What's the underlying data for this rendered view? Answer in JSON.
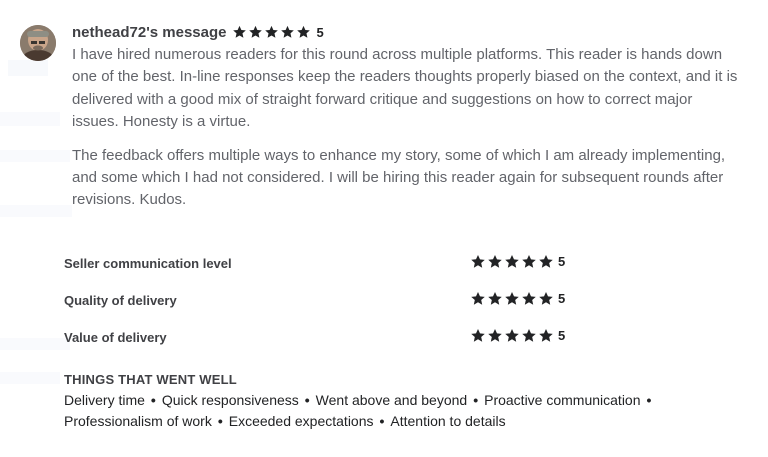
{
  "review": {
    "username": "nethead72's message",
    "rating": "5",
    "paragraphs": [
      "I have hired numerous readers for this round across multiple platforms. This reader is hands down one of the best. In-line responses keep the readers thoughts properly biased on the context, and it is delivered with a good mix of straight forward critique and suggestions on how to correct major issues. Honesty is a virtue.",
      "The feedback offers multiple ways to enhance my story, some of which I am already implementing, and some which I had not considered. I will be hiring this reader again for subsequent rounds after revisions. Kudos."
    ],
    "criteria": [
      {
        "label": "Seller communication level",
        "rating": "5"
      },
      {
        "label": "Quality of delivery",
        "rating": "5"
      },
      {
        "label": "Value of delivery",
        "rating": "5"
      }
    ],
    "went_well": {
      "title": "THINGS THAT WENT WELL",
      "tags": [
        "Delivery time",
        "Quick responsiveness",
        "Went above and beyond",
        "Proactive communication",
        "Professionalism of work",
        "Exceeded expectations",
        "Attention to details"
      ]
    }
  },
  "style": {
    "star_color": "#222325",
    "text_color": "#404145",
    "body_text_color": "#62646a"
  },
  "icons": {
    "avatar": "user-avatar-photo",
    "star": "star-icon"
  }
}
